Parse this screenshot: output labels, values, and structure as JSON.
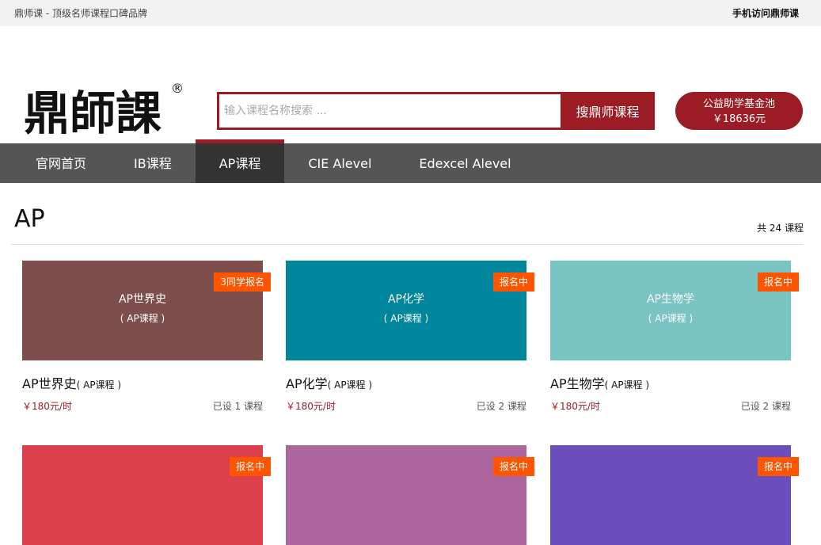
{
  "topbar": {
    "tagline": "鼎师课 - 顶级名师课程口碑品牌",
    "mobile_link": "手机访问鼎师课"
  },
  "logo": {
    "text": "鼎師課",
    "mark": "®"
  },
  "search": {
    "placeholder": "输入课程名称搜索 ...",
    "button": "搜鼎师课程"
  },
  "fund": {
    "line1": "公益助学基金池",
    "line2": "￥18636元"
  },
  "nav": {
    "items": [
      "官网首页",
      "IB课程",
      "AP课程",
      "CIE Alevel",
      "Edexcel Alevel"
    ],
    "active": 2
  },
  "section": {
    "title": "AP",
    "count": "共 24 课程"
  },
  "colors": {
    "brand": "#9b1c24",
    "badge": "#ff5500"
  },
  "courses": [
    {
      "thumb_title": "AP世界史",
      "thumb_sub": "( AP课程 )",
      "badge": "3同学报名",
      "name": "AP世界史",
      "name_sub": "( AP课程 )",
      "price": "￥180元/时",
      "sessions": "已设 1 课程",
      "color": "#7d4e4c"
    },
    {
      "thumb_title": "AP化学",
      "thumb_sub": "( AP课程 )",
      "badge": "报名中",
      "name": "AP化学",
      "name_sub": "( AP课程 )",
      "price": "￥180元/时",
      "sessions": "已设 2 课程",
      "color": "#00869c"
    },
    {
      "thumb_title": "AP生物学",
      "thumb_sub": "( AP课程 )",
      "badge": "报名中",
      "name": "AP生物学",
      "name_sub": "( AP课程 )",
      "price": "￥180元/时",
      "sessions": "已设 2 课程",
      "color": "#7bc4c4"
    },
    {
      "thumb_title": "",
      "thumb_sub": "",
      "badge": "报名中",
      "name": "",
      "name_sub": "",
      "price": "",
      "sessions": "",
      "color": "#dc404c"
    },
    {
      "thumb_title": "",
      "thumb_sub": "",
      "badge": "报名中",
      "name": "",
      "name_sub": "",
      "price": "",
      "sessions": "",
      "color": "#ad65a0"
    },
    {
      "thumb_title": "",
      "thumb_sub": "",
      "badge": "报名中",
      "name": "",
      "name_sub": "",
      "price": "",
      "sessions": "",
      "color": "#6b4dbc"
    }
  ]
}
